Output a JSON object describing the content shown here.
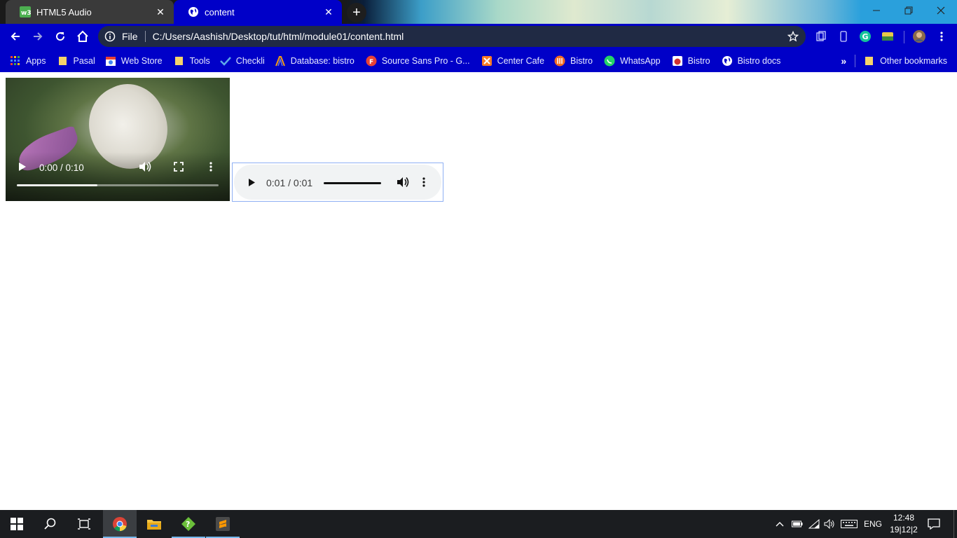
{
  "browser": {
    "tabs": [
      {
        "title": "HTML5 Audio",
        "active": false,
        "icon": "w3schools-icon"
      },
      {
        "title": "content",
        "active": true,
        "icon": "globe-icon"
      }
    ],
    "address": {
      "scheme_label": "File",
      "url": "C:/Users/Aashish/Desktop/tut/html/module01/content.html"
    },
    "bookmarks": [
      {
        "label": "Apps",
        "icon": "apps-grid-icon"
      },
      {
        "label": "Pasal",
        "icon": "folder-icon"
      },
      {
        "label": "Web Store",
        "icon": "webstore-icon"
      },
      {
        "label": "Tools",
        "icon": "folder-icon"
      },
      {
        "label": "Checkli",
        "icon": "checkmark-icon"
      },
      {
        "label": "Database: bistro",
        "icon": "phpmyadmin-icon"
      },
      {
        "label": "Source Sans Pro - G...",
        "icon": "google-fonts-icon"
      },
      {
        "label": "Center Cafe",
        "icon": "xampp-icon"
      },
      {
        "label": "Bistro",
        "icon": "bistro-icon"
      },
      {
        "label": "WhatsApp",
        "icon": "whatsapp-icon"
      },
      {
        "label": "Bistro",
        "icon": "bistro-red-icon"
      },
      {
        "label": "Bistro docs",
        "icon": "globe-icon"
      }
    ],
    "other_bookmarks": "Other bookmarks",
    "overflow_label": "»"
  },
  "page": {
    "video": {
      "time": "0:00 / 0:10",
      "buffered": 0.4
    },
    "audio": {
      "time": "0:01 / 0:01",
      "progress": 1.0
    }
  },
  "taskbar": {
    "language": "ENG",
    "time": "12:48",
    "date": "19|12|2"
  },
  "colors": {
    "toolbar": "#0000c8",
    "taskbar": "#1b1d20",
    "audio_bg": "#f1f3f4"
  }
}
